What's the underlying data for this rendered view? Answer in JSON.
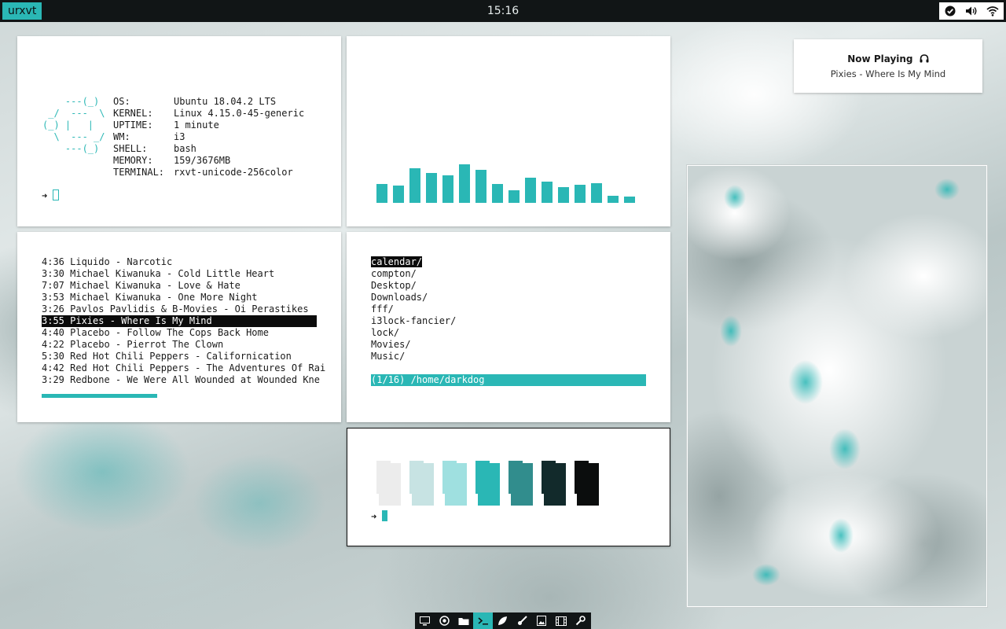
{
  "topbar": {
    "workspace": "urxvt",
    "clock": "15:16",
    "tray": [
      "check-circle-icon",
      "volume-icon",
      "wifi-icon"
    ]
  },
  "neofetch": {
    "art": [
      "    ---(_)",
      " _/  ---  \\",
      "(_) |   |",
      "  \\  --- _/",
      "    ---(_)"
    ],
    "info": [
      {
        "key": "OS:",
        "value": "Ubuntu 18.04.2 LTS"
      },
      {
        "key": "KERNEL:",
        "value": "Linux 4.15.0-45-generic"
      },
      {
        "key": "UPTIME:",
        "value": "1 minute"
      },
      {
        "key": "WM:",
        "value": "i3"
      },
      {
        "key": "SHELL:",
        "value": "bash"
      },
      {
        "key": "MEMORY:",
        "value": "159/3676MB"
      },
      {
        "key": "TERMINAL:",
        "value": "rxvt-unicode-256color"
      }
    ],
    "prompt": "➜"
  },
  "visualizer": {
    "levels": [
      0.4,
      0.37,
      0.73,
      0.63,
      0.58,
      0.82,
      0.7,
      0.4,
      0.26,
      0.53,
      0.45,
      0.33,
      0.38,
      0.42,
      0.15,
      0.13
    ],
    "color": "#2ab7b5"
  },
  "playlist": {
    "tracks": [
      "4:36 Liquido - Narcotic",
      "3:30 Michael Kiwanuka - Cold Little Heart",
      "7:07 Michael Kiwanuka - Love & Hate",
      "3:53 Michael Kiwanuka - One More Night",
      "3:26 Pavlos Pavlidis & B-Movies - Oi Perastikes",
      "3:55 Pixies - Where Is My Mind",
      "4:40 Placebo - Follow The Cops Back Home",
      "4:22 Placebo - Pierrot The Clown",
      "5:30 Red Hot Chili Peppers - Californication",
      "4:42 Red Hot Chili Peppers - The Adventures Of Rai",
      "3:29 Redbone - We Were All Wounded at Wounded Kne"
    ],
    "selected_index": 5,
    "progress": 0.42
  },
  "filemanager": {
    "entries": [
      "calendar/",
      "compton/",
      "Desktop/",
      "Downloads/",
      "fff/",
      "i3lock-fancier/",
      "lock/",
      "Movies/",
      "Music/"
    ],
    "selected_index": 0,
    "status": "(1/16) /home/darkdog"
  },
  "colors": {
    "swatches": [
      "#ececec",
      "#c7e3e3",
      "#9fe0e0",
      "#2ab7b5",
      "#318d8d",
      "#122a2b",
      "#0b0d0d"
    ],
    "prompt": "➜"
  },
  "now_playing": {
    "title": "Now Playing",
    "track": "Pixies - Where Is My Mind"
  },
  "dock": {
    "items": [
      "desktop-icon",
      "browser-icon",
      "folder-icon",
      "terminal-icon",
      "leaf-icon",
      "brush-icon",
      "image-icon",
      "film-icon",
      "wrench-icon"
    ],
    "active_index": 3
  }
}
